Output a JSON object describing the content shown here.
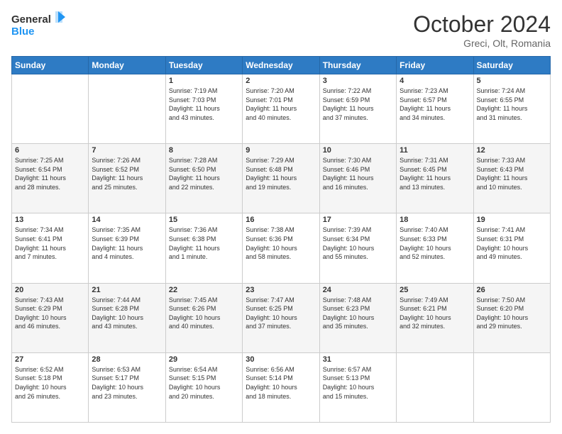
{
  "header": {
    "logo_line1": "General",
    "logo_line2": "Blue",
    "month": "October 2024",
    "location": "Greci, Olt, Romania"
  },
  "weekdays": [
    "Sunday",
    "Monday",
    "Tuesday",
    "Wednesday",
    "Thursday",
    "Friday",
    "Saturday"
  ],
  "weeks": [
    [
      {
        "day": "",
        "info": ""
      },
      {
        "day": "",
        "info": ""
      },
      {
        "day": "1",
        "info": "Sunrise: 7:19 AM\nSunset: 7:03 PM\nDaylight: 11 hours\nand 43 minutes."
      },
      {
        "day": "2",
        "info": "Sunrise: 7:20 AM\nSunset: 7:01 PM\nDaylight: 11 hours\nand 40 minutes."
      },
      {
        "day": "3",
        "info": "Sunrise: 7:22 AM\nSunset: 6:59 PM\nDaylight: 11 hours\nand 37 minutes."
      },
      {
        "day": "4",
        "info": "Sunrise: 7:23 AM\nSunset: 6:57 PM\nDaylight: 11 hours\nand 34 minutes."
      },
      {
        "day": "5",
        "info": "Sunrise: 7:24 AM\nSunset: 6:55 PM\nDaylight: 11 hours\nand 31 minutes."
      }
    ],
    [
      {
        "day": "6",
        "info": "Sunrise: 7:25 AM\nSunset: 6:54 PM\nDaylight: 11 hours\nand 28 minutes."
      },
      {
        "day": "7",
        "info": "Sunrise: 7:26 AM\nSunset: 6:52 PM\nDaylight: 11 hours\nand 25 minutes."
      },
      {
        "day": "8",
        "info": "Sunrise: 7:28 AM\nSunset: 6:50 PM\nDaylight: 11 hours\nand 22 minutes."
      },
      {
        "day": "9",
        "info": "Sunrise: 7:29 AM\nSunset: 6:48 PM\nDaylight: 11 hours\nand 19 minutes."
      },
      {
        "day": "10",
        "info": "Sunrise: 7:30 AM\nSunset: 6:46 PM\nDaylight: 11 hours\nand 16 minutes."
      },
      {
        "day": "11",
        "info": "Sunrise: 7:31 AM\nSunset: 6:45 PM\nDaylight: 11 hours\nand 13 minutes."
      },
      {
        "day": "12",
        "info": "Sunrise: 7:33 AM\nSunset: 6:43 PM\nDaylight: 11 hours\nand 10 minutes."
      }
    ],
    [
      {
        "day": "13",
        "info": "Sunrise: 7:34 AM\nSunset: 6:41 PM\nDaylight: 11 hours\nand 7 minutes."
      },
      {
        "day": "14",
        "info": "Sunrise: 7:35 AM\nSunset: 6:39 PM\nDaylight: 11 hours\nand 4 minutes."
      },
      {
        "day": "15",
        "info": "Sunrise: 7:36 AM\nSunset: 6:38 PM\nDaylight: 11 hours\nand 1 minute."
      },
      {
        "day": "16",
        "info": "Sunrise: 7:38 AM\nSunset: 6:36 PM\nDaylight: 10 hours\nand 58 minutes."
      },
      {
        "day": "17",
        "info": "Sunrise: 7:39 AM\nSunset: 6:34 PM\nDaylight: 10 hours\nand 55 minutes."
      },
      {
        "day": "18",
        "info": "Sunrise: 7:40 AM\nSunset: 6:33 PM\nDaylight: 10 hours\nand 52 minutes."
      },
      {
        "day": "19",
        "info": "Sunrise: 7:41 AM\nSunset: 6:31 PM\nDaylight: 10 hours\nand 49 minutes."
      }
    ],
    [
      {
        "day": "20",
        "info": "Sunrise: 7:43 AM\nSunset: 6:29 PM\nDaylight: 10 hours\nand 46 minutes."
      },
      {
        "day": "21",
        "info": "Sunrise: 7:44 AM\nSunset: 6:28 PM\nDaylight: 10 hours\nand 43 minutes."
      },
      {
        "day": "22",
        "info": "Sunrise: 7:45 AM\nSunset: 6:26 PM\nDaylight: 10 hours\nand 40 minutes."
      },
      {
        "day": "23",
        "info": "Sunrise: 7:47 AM\nSunset: 6:25 PM\nDaylight: 10 hours\nand 37 minutes."
      },
      {
        "day": "24",
        "info": "Sunrise: 7:48 AM\nSunset: 6:23 PM\nDaylight: 10 hours\nand 35 minutes."
      },
      {
        "day": "25",
        "info": "Sunrise: 7:49 AM\nSunset: 6:21 PM\nDaylight: 10 hours\nand 32 minutes."
      },
      {
        "day": "26",
        "info": "Sunrise: 7:50 AM\nSunset: 6:20 PM\nDaylight: 10 hours\nand 29 minutes."
      }
    ],
    [
      {
        "day": "27",
        "info": "Sunrise: 6:52 AM\nSunset: 5:18 PM\nDaylight: 10 hours\nand 26 minutes."
      },
      {
        "day": "28",
        "info": "Sunrise: 6:53 AM\nSunset: 5:17 PM\nDaylight: 10 hours\nand 23 minutes."
      },
      {
        "day": "29",
        "info": "Sunrise: 6:54 AM\nSunset: 5:15 PM\nDaylight: 10 hours\nand 20 minutes."
      },
      {
        "day": "30",
        "info": "Sunrise: 6:56 AM\nSunset: 5:14 PM\nDaylight: 10 hours\nand 18 minutes."
      },
      {
        "day": "31",
        "info": "Sunrise: 6:57 AM\nSunset: 5:13 PM\nDaylight: 10 hours\nand 15 minutes."
      },
      {
        "day": "",
        "info": ""
      },
      {
        "day": "",
        "info": ""
      }
    ]
  ]
}
